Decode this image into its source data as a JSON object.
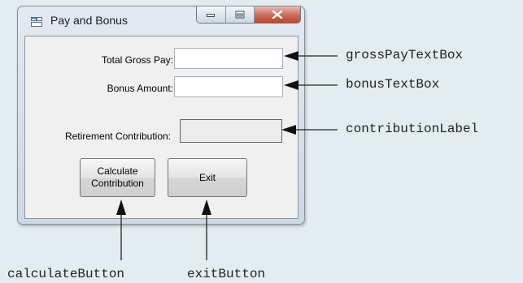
{
  "window": {
    "title": "Pay and Bonus"
  },
  "form": {
    "gross_pay_label": "Total Gross Pay:",
    "bonus_label": "Bonus Amount:",
    "contribution_label": "Retirement Contribution:",
    "gross_pay_value": "",
    "bonus_value": "",
    "contribution_value": ""
  },
  "buttons": {
    "calculate_line1": "Calculate",
    "calculate_line2": "Contribution",
    "exit": "Exit"
  },
  "callouts": {
    "gross_pay": "grossPayTextBox",
    "bonus": "bonusTextBox",
    "contribution": "contributionLabel",
    "calculate": "calculateButton",
    "exit": "exitButton"
  },
  "colors": {
    "background": "#e3ecee",
    "close_button": "#c96a58"
  },
  "icons": [
    "window-app-icon",
    "minimize-icon",
    "maximize-icon",
    "close-icon",
    "arrow-icon"
  ]
}
